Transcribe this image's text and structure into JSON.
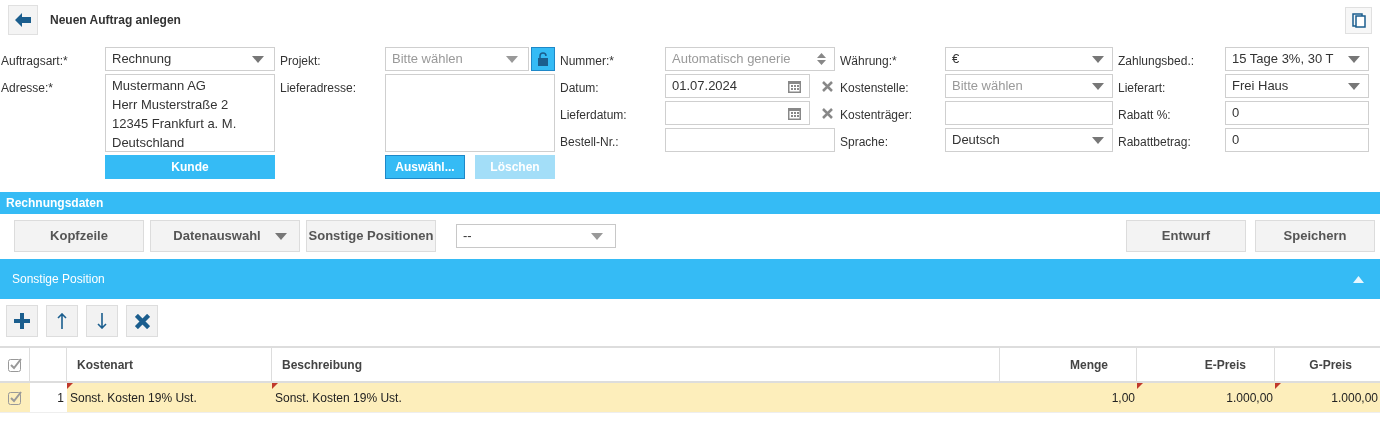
{
  "header": {
    "title": "Neuen Auftrag anlegen"
  },
  "order_type": {
    "label": "Auftragsart:*",
    "value": "Rechnung"
  },
  "address": {
    "label": "Adresse:*",
    "lines": [
      "Mustermann AG",
      "Herr Musterstraße 2",
      "12345 Frankfurt a. M.",
      "Deutschland"
    ],
    "button": "Kunde"
  },
  "project": {
    "label": "Projekt:",
    "placeholder": "Bitte wählen"
  },
  "delivery_address": {
    "label": "Lieferadresse:",
    "buttons": [
      {
        "label": "Auswähl...",
        "disabled": false
      },
      {
        "label": "Löschen",
        "disabled": true
      }
    ]
  },
  "form_columns": [
    [
      {
        "kind": "spinner",
        "label": "Nummer:*",
        "placeholder": "Automatisch generie"
      },
      {
        "kind": "date",
        "label": "Datum:",
        "value": "01.07.2024"
      },
      {
        "kind": "date",
        "label": "Lieferdatum:"
      },
      {
        "kind": "text",
        "label": "Bestell-Nr.:"
      }
    ],
    [
      {
        "kind": "select",
        "label": "Währung:*",
        "value": "€"
      },
      {
        "kind": "select",
        "label": "Kostenstelle:",
        "placeholder": "Bitte wählen"
      },
      {
        "kind": "text",
        "label": "Kostenträger:"
      },
      {
        "kind": "select",
        "label": "Sprache:",
        "value": "Deutsch"
      }
    ],
    [
      {
        "kind": "select",
        "label": "Zahlungsbed.:",
        "value": "15 Tage 3%, 30 T"
      },
      {
        "kind": "select",
        "label": "Lieferart:",
        "value": "Frei Haus"
      },
      {
        "kind": "text",
        "label": "Rabatt %:",
        "value": "0"
      },
      {
        "kind": "text",
        "label": "Rabattbetrag:",
        "value": "0"
      }
    ]
  ],
  "invoice_section": {
    "title": "Rechnungsdaten",
    "left_buttons": [
      {
        "label": "Kopfzeile",
        "dropdown": false
      },
      {
        "label": "Datenauswahl",
        "dropdown": true
      },
      {
        "label": "Sonstige Positionen",
        "dropdown": false
      }
    ],
    "filter": {
      "value": "--"
    },
    "right_buttons": [
      "Entwurf",
      "Speichern"
    ]
  },
  "positions_section": {
    "title": "Sonstige Position",
    "expanded": true
  },
  "table": {
    "all_checked": true,
    "columns": [
      "Kostenart",
      "Beschreibung",
      "Menge",
      "E-Preis",
      "G-Preis"
    ],
    "rows": [
      {
        "checked": true,
        "index": "1",
        "cells": [
          {
            "text": "Sonst. Kosten 19% Ust.",
            "modified": true
          },
          {
            "text": "Sonst. Kosten 19% Ust.",
            "modified": true
          },
          {
            "text": "1,00",
            "modified": false
          },
          {
            "text": "1.000,00",
            "modified": true
          },
          {
            "text": "1.000,00",
            "modified": true
          }
        ]
      }
    ]
  }
}
